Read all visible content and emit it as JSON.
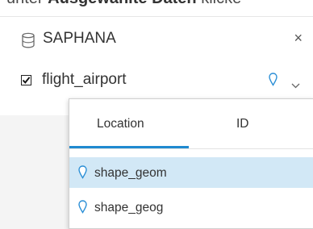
{
  "header_crop": {
    "prefix": "unter ",
    "bold": "Ausgewählte Daten",
    "suffix": " klicke"
  },
  "source": {
    "name": "SAPHANA",
    "icon": "database-icon",
    "close_label": "×"
  },
  "table": {
    "name": "flight_airport",
    "checked": true,
    "location_icon": "location-pin-icon",
    "menu_icon": "caret-down-icon"
  },
  "popup": {
    "tabs": [
      {
        "label": "Location",
        "active": true
      },
      {
        "label": "ID",
        "active": false
      }
    ],
    "options": [
      {
        "label": "shape_geom",
        "icon": "location-pin-icon",
        "selected": true
      },
      {
        "label": "shape_geog",
        "icon": "location-pin-icon",
        "selected": false
      }
    ]
  },
  "colors": {
    "accent": "#1f8ad0",
    "selected_bg": "#d2e8f6",
    "pin": "#2b8fd6"
  }
}
